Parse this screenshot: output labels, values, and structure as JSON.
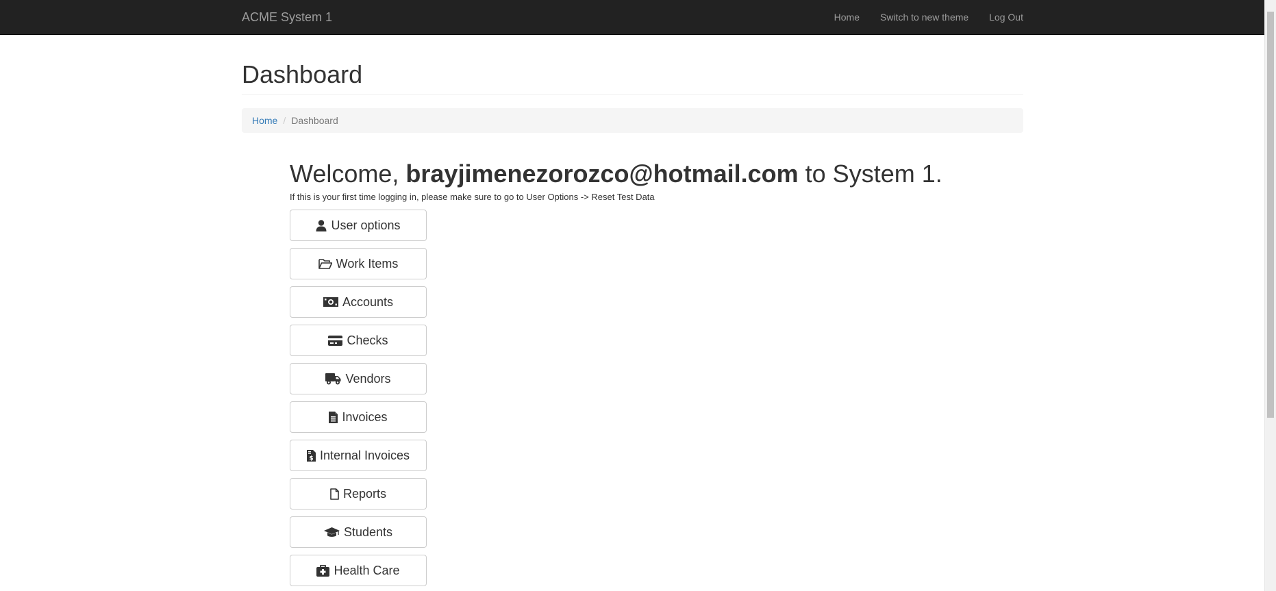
{
  "navbar": {
    "brand": "ACME System 1",
    "links": [
      "Home",
      "Switch to new theme",
      "Log Out"
    ]
  },
  "page": {
    "title": "Dashboard"
  },
  "breadcrumb": {
    "home": "Home",
    "current": "Dashboard"
  },
  "welcome": {
    "prefix": "Welcome,",
    "email": "brayjimenezorozco@hotmail.com",
    "suffix": "to System 1.",
    "hint": "If this is your first time logging in, please make sure to go to User Options -> Reset Test Data"
  },
  "menu": [
    {
      "label": "User options",
      "icon": "user-icon"
    },
    {
      "label": "Work Items",
      "icon": "folder-open-icon"
    },
    {
      "label": "Accounts",
      "icon": "money-bill-icon"
    },
    {
      "label": "Checks",
      "icon": "credit-card-icon"
    },
    {
      "label": "Vendors",
      "icon": "truck-icon"
    },
    {
      "label": "Invoices",
      "icon": "file-alt-icon"
    },
    {
      "label": "Internal Invoices",
      "icon": "file-invoice-dollar-icon"
    },
    {
      "label": "Reports",
      "icon": "file-icon"
    },
    {
      "label": "Students",
      "icon": "graduation-cap-icon"
    },
    {
      "label": "Health Care",
      "icon": "medkit-icon"
    }
  ]
}
